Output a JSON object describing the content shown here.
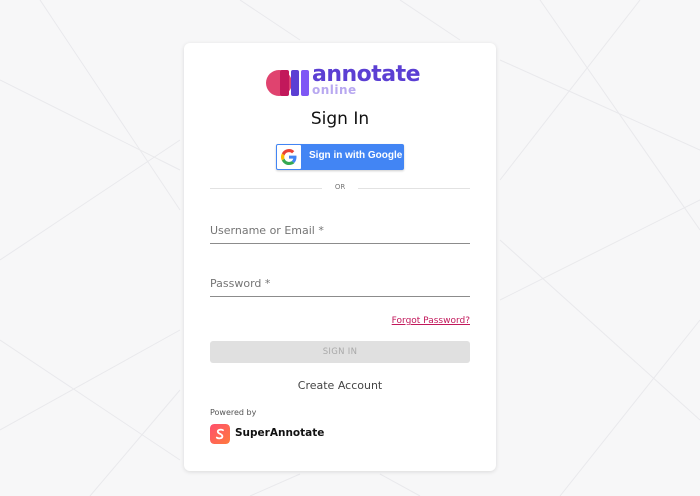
{
  "brand": {
    "name": "annotate",
    "sub": "online"
  },
  "form": {
    "title": "Sign In",
    "google_label": "Sign in with Google",
    "or_label": "OR",
    "username_label": "Username or Email *",
    "password_label": "Password *",
    "forgot_label": "Forgot Password?",
    "signin_label": "SIGN IN",
    "create_label": "Create Account"
  },
  "footer": {
    "powered_by": "Powered by",
    "company": "SuperAnnotate"
  },
  "colors": {
    "brand_primary": "#5b3fd3",
    "google_blue": "#4285f4",
    "link_pink": "#c2185b",
    "disabled_button": "#e0e0e0"
  }
}
